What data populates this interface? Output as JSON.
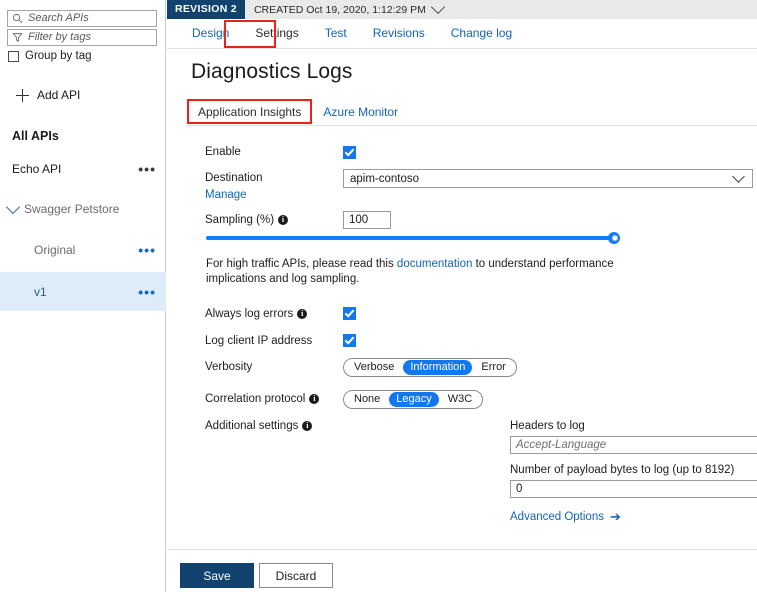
{
  "sidebar": {
    "search": {
      "placeholder": "Search APIs",
      "icon": "search-icon"
    },
    "filter": {
      "placeholder": "Filter by tags",
      "icon": "filter-icon"
    },
    "group_by_tag": "Group by tag",
    "add_api": "+ Add API",
    "add_api_label": "Add API",
    "items": [
      {
        "label": "All APIs",
        "menu": "•••",
        "has_menu": false
      },
      {
        "label": "Echo API",
        "menu": "•••",
        "has_menu": true
      },
      {
        "label": "Swagger Petstore",
        "menu": "",
        "has_menu": false
      },
      {
        "label": "Original",
        "menu": "•••",
        "has_menu": true
      },
      {
        "label": "v1",
        "menu": "•••",
        "has_menu": true
      }
    ]
  },
  "revision_bar": {
    "badge": "REVISION 2",
    "created": "CREATED Oct 19, 2020, 1:12:29 PM"
  },
  "top_tabs": [
    {
      "label": "Design",
      "active": false
    },
    {
      "label": "Settings",
      "active": true
    },
    {
      "label": "Test",
      "active": false
    },
    {
      "label": "Revisions",
      "active": false
    },
    {
      "label": "Change log",
      "active": false
    }
  ],
  "page": {
    "title": "Diagnostics Logs",
    "sub_tabs": [
      {
        "label": "Application Insights",
        "active": true
      },
      {
        "label": "Azure Monitor",
        "active": false
      }
    ]
  },
  "form": {
    "enable": {
      "label": "Enable",
      "checked": true
    },
    "destination": {
      "label": "Destination",
      "manage_link": "Manage",
      "value": "apim-contoso"
    },
    "sampling": {
      "label": "Sampling (%)",
      "value": "100",
      "percent": 100,
      "help_before": "For high traffic APIs, please read this ",
      "help_link": "documentation",
      "help_after": " to understand performance implications and log sampling."
    },
    "always_log_errors": {
      "label": "Always log errors",
      "checked": true
    },
    "log_client_ip": {
      "label": "Log client IP address",
      "checked": true
    },
    "verbosity": {
      "label": "Verbosity",
      "options": [
        "Verbose",
        "Information",
        "Error"
      ],
      "selected": "Information"
    },
    "correlation_protocol": {
      "label": "Correlation protocol",
      "options": [
        "None",
        "Legacy",
        "W3C"
      ],
      "selected": "Legacy"
    },
    "additional_settings": {
      "label": "Additional settings",
      "headers_label": "Headers to log",
      "headers_placeholder": "Accept-Language",
      "payload_label": "Number of payload bytes to log (up to 8192)",
      "payload_value": "0",
      "advanced_link": "Advanced Options",
      "advanced_arrow": "➔"
    }
  },
  "footer": {
    "save": "Save",
    "discard": "Discard"
  },
  "colors": {
    "accent_blue": "#1266b3",
    "slider_blue": "#107bff",
    "pill_selected": "#1278f2",
    "save_navy": "#12426e",
    "highlight_red": "#e8231a",
    "selected_row": "#deecf9"
  }
}
